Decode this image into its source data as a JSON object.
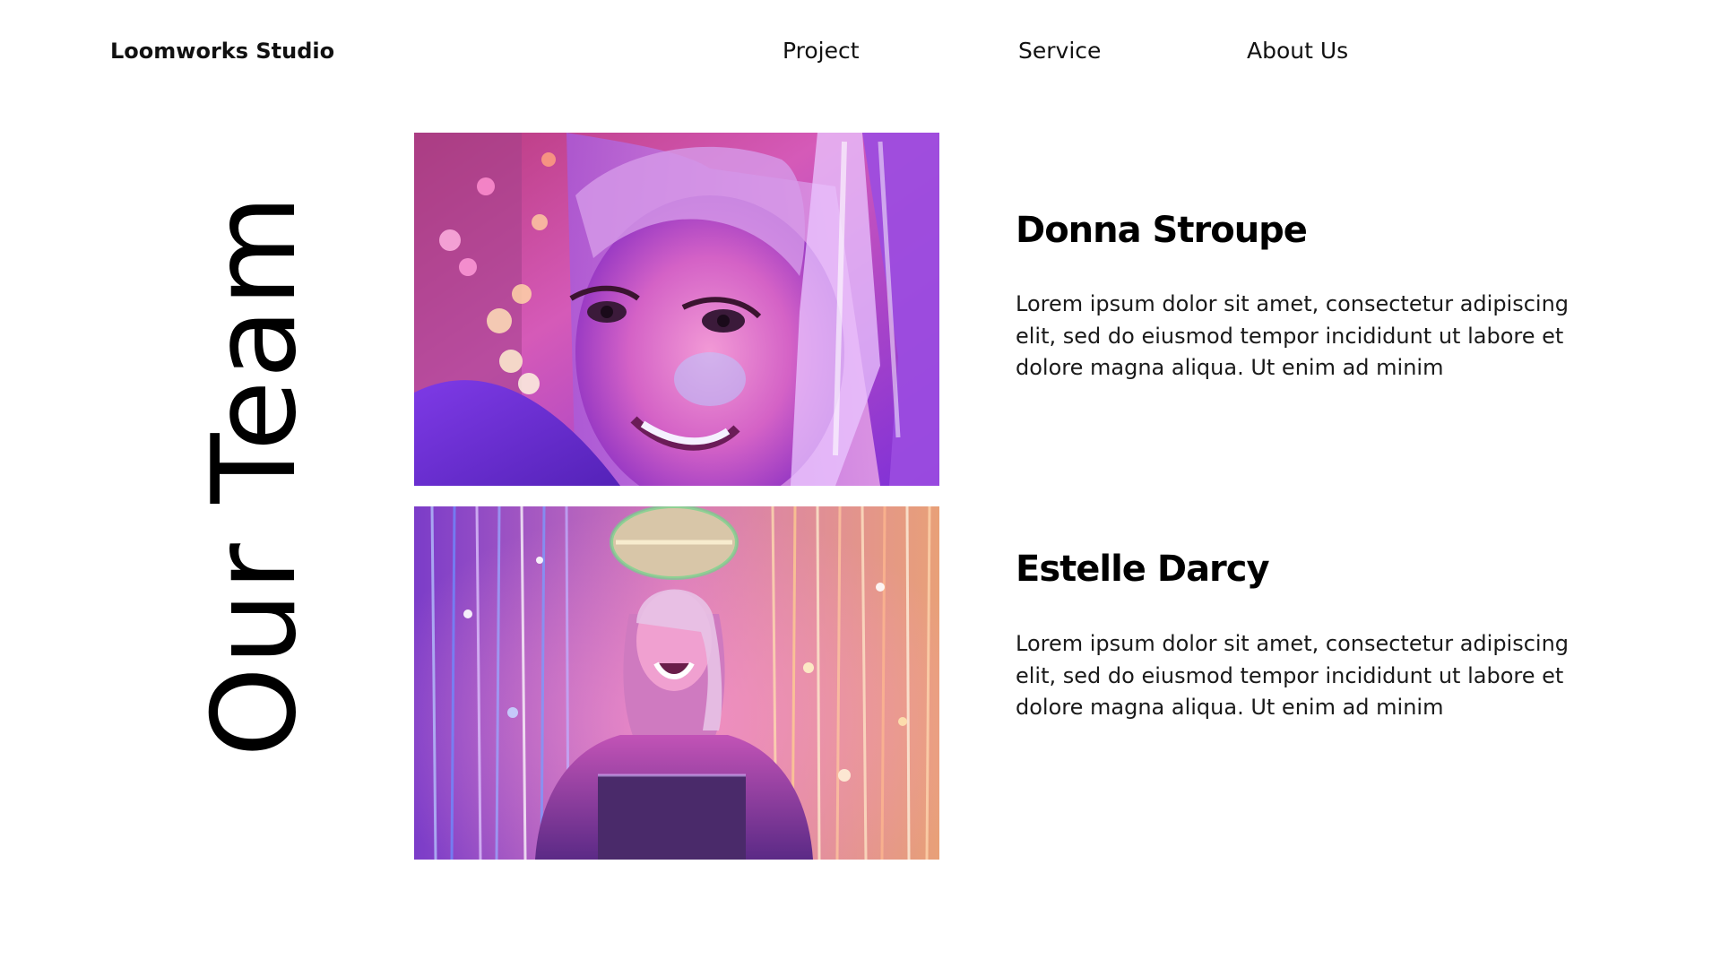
{
  "brand": {
    "name": "Loomworks Studio"
  },
  "nav": {
    "items": [
      {
        "label": "Project"
      },
      {
        "label": "Service"
      },
      {
        "label": "About Us"
      }
    ]
  },
  "section": {
    "title": "Our Team"
  },
  "team": {
    "members": [
      {
        "name": "Donna Stroupe",
        "bio": "Lorem ipsum dolor sit amet, consectetur adipiscing elit, sed do eiusmod tempor incididunt ut labore et dolore magna aliqua. Ut enim ad minim"
      },
      {
        "name": "Estelle Darcy",
        "bio": "Lorem ipsum dolor sit amet, consectetur adipiscing elit, sed do eiusmod tempor incididunt ut labore et dolore magna aliqua. Ut enim ad minim"
      }
    ]
  },
  "colors": {
    "background": "#ffffff",
    "text": "#111111",
    "photo_magenta": "#c43ad6",
    "photo_violet": "#6a2bd9",
    "photo_pink": "#f07ab0"
  }
}
